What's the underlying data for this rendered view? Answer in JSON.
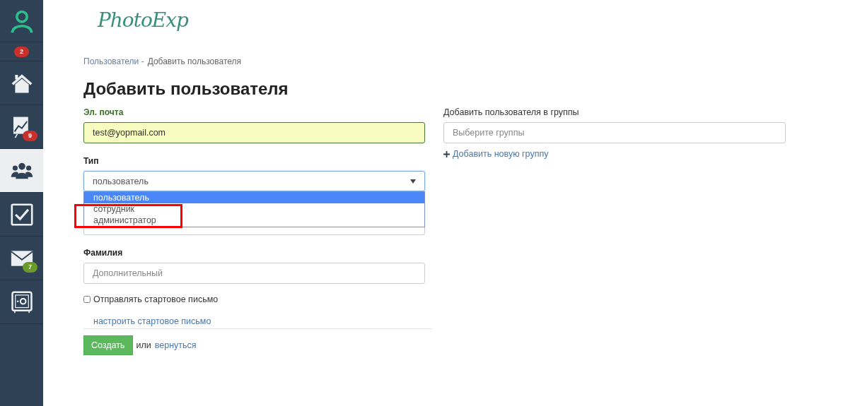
{
  "sidebar": {
    "items": [
      {
        "kind": "avatar",
        "selected": false
      },
      {
        "kind": "badge-row",
        "badge": "2",
        "color": "#c9302c",
        "selected": false
      },
      {
        "kind": "home",
        "selected": false
      },
      {
        "kind": "chart",
        "badge": "9",
        "color": "#c9302c",
        "selected": false
      },
      {
        "kind": "users",
        "selected": true
      },
      {
        "kind": "check",
        "selected": false
      },
      {
        "kind": "mail",
        "badge": "7",
        "color": "#6a9a2a",
        "selected": false
      },
      {
        "kind": "safe",
        "selected": false
      }
    ]
  },
  "logo": "PhotoExp",
  "breadcrumb": [
    {
      "label": "Пользователи -",
      "link": true
    },
    {
      "label": "Добавить пользователя",
      "link": false
    }
  ],
  "heading": "Добавить пользователя",
  "form": {
    "email": {
      "label": "Эл. почта",
      "value": "test@yopmail.com"
    },
    "type": {
      "label": "Тип",
      "value": "пользователь",
      "expanded": true,
      "options": [
        {
          "label": "пользователь",
          "selected": true
        },
        {
          "label": "сотрудник",
          "selected": false
        },
        {
          "label": "администратор",
          "selected": false
        }
      ]
    },
    "last_name": {
      "label": "Фамилия",
      "placeholder": "Дополнительный"
    },
    "send_letter": {
      "label": "Отправлять стартовое письмо",
      "checked": false
    },
    "configure_link": "настроить стартовое письмо",
    "submit": "Создать",
    "or_text": "или",
    "back_link": "вернуться"
  },
  "groups": {
    "label": "Добавить пользователя в группы",
    "placeholder": "Выберите группы",
    "add_link": "Добавить новую группу"
  }
}
